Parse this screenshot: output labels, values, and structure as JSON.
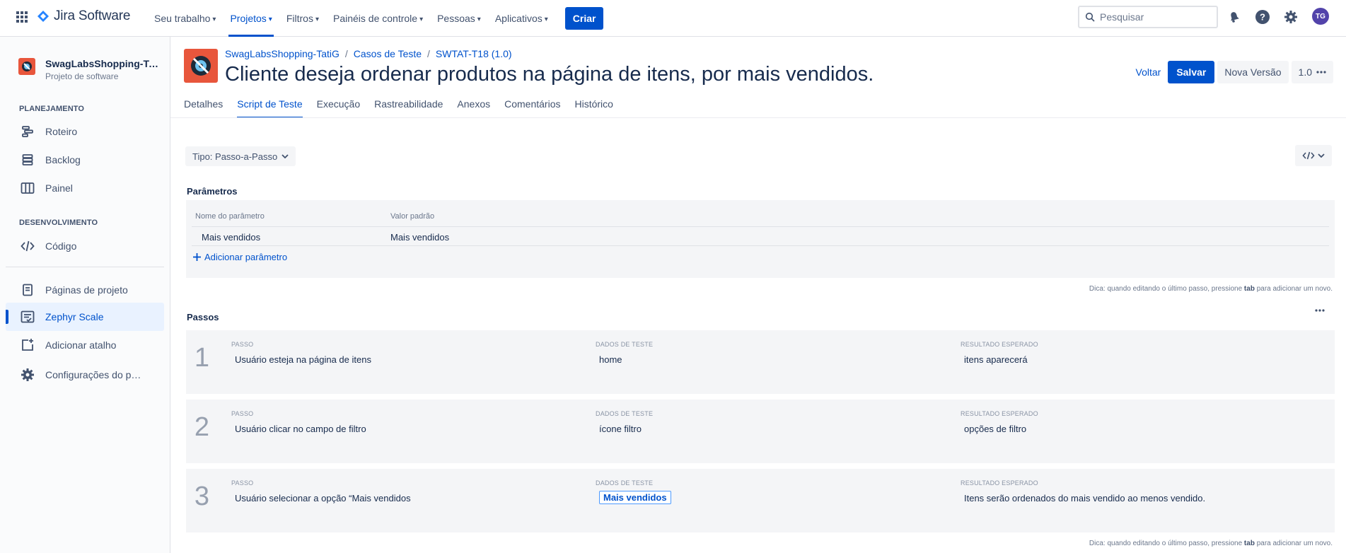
{
  "topnav": {
    "brand": "Jira Software",
    "items": [
      {
        "label": "Seu trabalho"
      },
      {
        "label": "Projetos"
      },
      {
        "label": "Filtros"
      },
      {
        "label": "Painéis de controle"
      },
      {
        "label": "Pessoas"
      },
      {
        "label": "Aplicativos"
      }
    ],
    "active_index": 1,
    "create_label": "Criar",
    "search_placeholder": "Pesquisar",
    "avatar_initials": "TG"
  },
  "sidebar": {
    "project_name": "SwagLabsShopping-TatiG",
    "project_type": "Projeto de software",
    "sections": {
      "planning": "PLANEJAMENTO",
      "development": "DESENVOLVIMENTO"
    },
    "items": {
      "roadmap": "Roteiro",
      "backlog": "Backlog",
      "board": "Painel",
      "code": "Código",
      "pages": "Páginas de projeto",
      "zephyr": "Zephyr Scale",
      "shortcut": "Adicionar atalho",
      "settings": "Configurações do projeto"
    }
  },
  "header": {
    "breadcrumb": [
      "SwagLabsShopping-TatiG",
      "Casos de Teste",
      "SWTAT-T18 (1.0)"
    ],
    "separator": "/",
    "title": "Cliente deseja ordenar produtos na página de itens, por mais vendidos.",
    "back_label": "Voltar",
    "save_label": "Salvar",
    "new_version_label": "Nova Versão",
    "version": "1.0"
  },
  "tabs": [
    "Detalhes",
    "Script de Teste",
    "Execução",
    "Rastreabilidade",
    "Anexos",
    "Comentários",
    "Histórico"
  ],
  "active_tab": 1,
  "script": {
    "type_label": "Tipo: Passo-a-Passo",
    "params_title": "Parâmetros",
    "param_name_header": "Nome do parâmetro",
    "param_default_header": "Valor padrão",
    "param_name": "Mais vendidos",
    "param_default": "Mais vendidos",
    "add_param_label": "Adicionar parâmetro",
    "hint_prefix": "Dica: quando editando o último passo, pressione",
    "hint_key": "tab",
    "hint_suffix": "para adicionar um novo.",
    "steps_title": "Passos",
    "col_step": "PASSO",
    "col_data": "DADOS DE TESTE",
    "col_result": "RESULTADO ESPERADO",
    "steps": [
      {
        "num": "1",
        "step": "Usuário esteja na página de itens",
        "data": "home",
        "result": "itens aparecerá"
      },
      {
        "num": "2",
        "step": "Usuário clicar no campo de filtro",
        "data": "ícone filtro",
        "result": "opções de filtro"
      },
      {
        "num": "3",
        "step": "Usuário selecionar a opção “Mais vendidos",
        "data": "Mais vendidos",
        "result": "Itens serão ordenados do mais vendido ao menos vendido."
      }
    ]
  },
  "colors": {
    "brand_blue": "#0052cc",
    "project_icon": "#e8563c",
    "avatar": "#5243aa"
  }
}
